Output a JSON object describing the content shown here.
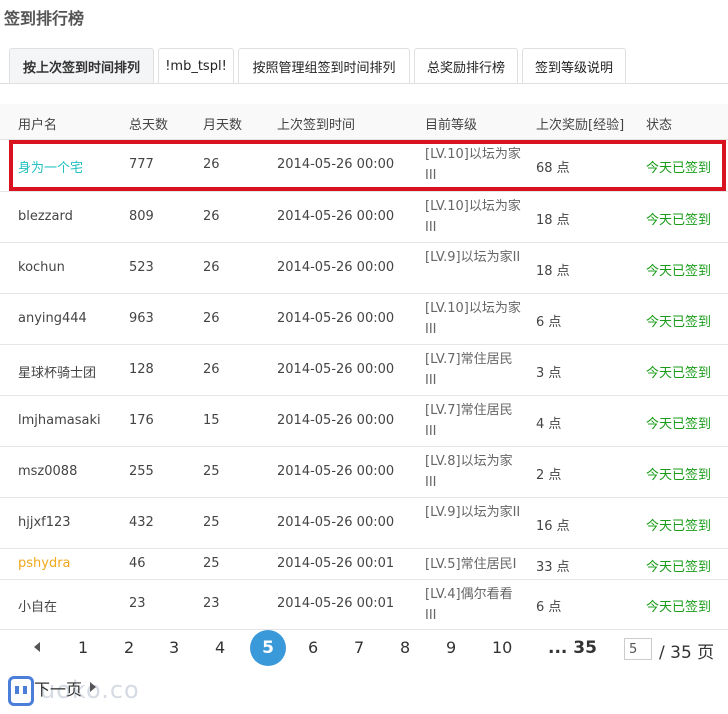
{
  "page_title": "签到排行榜",
  "tabs": [
    {
      "label": "按上次签到时间排列"
    },
    {
      "label": "!mb_tspl!"
    },
    {
      "label": "按照管理组签到时间排列"
    },
    {
      "label": "总奖励排行榜"
    },
    {
      "label": "签到等级说明"
    }
  ],
  "table": {
    "headers": [
      "用户名",
      "总天数",
      "月天数",
      "上次签到时间",
      "目前等级",
      "上次奖励[经验]",
      "状态"
    ],
    "rows": [
      {
        "user": "身为一个宅",
        "total": "777",
        "month": "26",
        "time": "2014-05-26 00:00",
        "level": "[LV.10]以坛为家III",
        "reward": "68 点",
        "status": "今天已签到"
      },
      {
        "user": "blezzard",
        "total": "809",
        "month": "26",
        "time": "2014-05-26 00:00",
        "level": "[LV.10]以坛为家III",
        "reward": "18 点",
        "status": "今天已签到"
      },
      {
        "user": "kochun",
        "total": "523",
        "month": "26",
        "time": "2014-05-26 00:00",
        "level": "[LV.9]以坛为家II",
        "reward": "18 点",
        "status": "今天已签到"
      },
      {
        "user": "anying444",
        "total": "963",
        "month": "26",
        "time": "2014-05-26 00:00",
        "level": "[LV.10]以坛为家III",
        "reward": "6 点",
        "status": "今天已签到"
      },
      {
        "user": "星球杯骑士团",
        "total": "128",
        "month": "26",
        "time": "2014-05-26 00:00",
        "level": "[LV.7]常住居民III",
        "reward": "3 点",
        "status": "今天已签到"
      },
      {
        "user": "lmjhamasaki",
        "total": "176",
        "month": "15",
        "time": "2014-05-26 00:00",
        "level": "[LV.7]常住居民III",
        "reward": "4 点",
        "status": "今天已签到"
      },
      {
        "user": "msz0088",
        "total": "255",
        "month": "25",
        "time": "2014-05-26 00:00",
        "level": "[LV.8]以坛为家III",
        "reward": "2 点",
        "status": "今天已签到"
      },
      {
        "user": "hjjxf123",
        "total": "432",
        "month": "25",
        "time": "2014-05-26 00:00",
        "level": "[LV.9]以坛为家II",
        "reward": "16 点",
        "status": "今天已签到"
      },
      {
        "user": "pshydra",
        "total": "46",
        "month": "25",
        "time": "2014-05-26 00:01",
        "level": "[LV.5]常住居民I",
        "reward": "33 点",
        "status": "今天已签到"
      },
      {
        "user": "小自在",
        "total": "23",
        "month": "23",
        "time": "2014-05-26 00:01",
        "level": "[LV.4]偶尔看看III",
        "reward": "6 点",
        "status": "今天已签到"
      }
    ]
  },
  "pagination": {
    "pages": [
      "1",
      "2",
      "3",
      "4",
      "5",
      "6",
      "7",
      "8",
      "9",
      "10",
      "... 35"
    ],
    "current": "5",
    "input_value": "5",
    "total_label": "/ 35 页",
    "next_label": "下一页"
  },
  "watermark": "uoko.co",
  "colors": {
    "accent": "#3a99d8",
    "status": "#1a9c1a",
    "highlight": "#d8131f",
    "user_cyan": "#23c1c1",
    "user_gold": "#f0a81c"
  }
}
